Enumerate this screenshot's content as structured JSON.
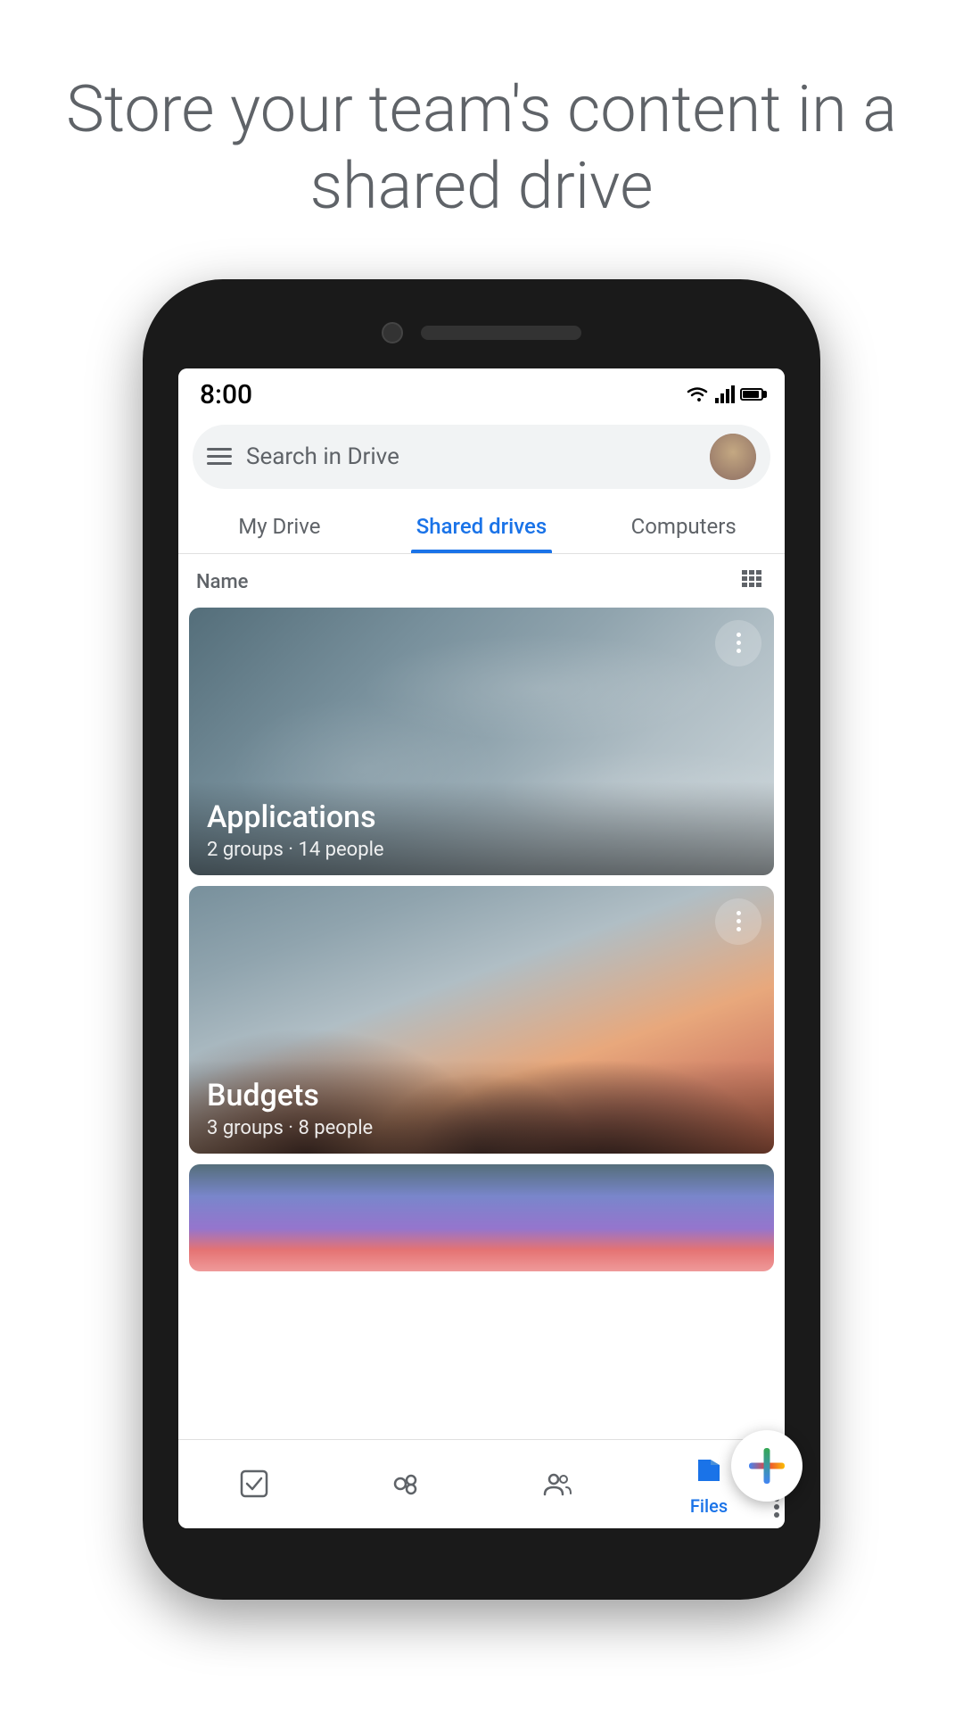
{
  "page": {
    "header": "Store your team's content in a shared drive"
  },
  "status_bar": {
    "time": "8:00"
  },
  "search_bar": {
    "placeholder": "Search in Drive"
  },
  "tabs": [
    {
      "id": "my-drive",
      "label": "My Drive",
      "active": false
    },
    {
      "id": "shared-drives",
      "label": "Shared drives",
      "active": true
    },
    {
      "id": "computers",
      "label": "Computers",
      "active": false
    }
  ],
  "list_header": {
    "name_label": "Name"
  },
  "drives": [
    {
      "id": "applications",
      "title": "Applications",
      "subtitle": "2 groups · 14 people",
      "theme": "ocean"
    },
    {
      "id": "budgets",
      "title": "Budgets",
      "subtitle": "3 groups · 8 people",
      "theme": "mountain"
    },
    {
      "id": "third",
      "title": "",
      "subtitle": "",
      "theme": "sky"
    }
  ],
  "bottom_nav": [
    {
      "id": "priority",
      "icon": "checkbox-icon",
      "label": ""
    },
    {
      "id": "shared",
      "icon": "shared-icon",
      "label": ""
    },
    {
      "id": "people",
      "icon": "people-icon",
      "label": ""
    },
    {
      "id": "files",
      "icon": "files-icon",
      "label": "Files"
    }
  ]
}
